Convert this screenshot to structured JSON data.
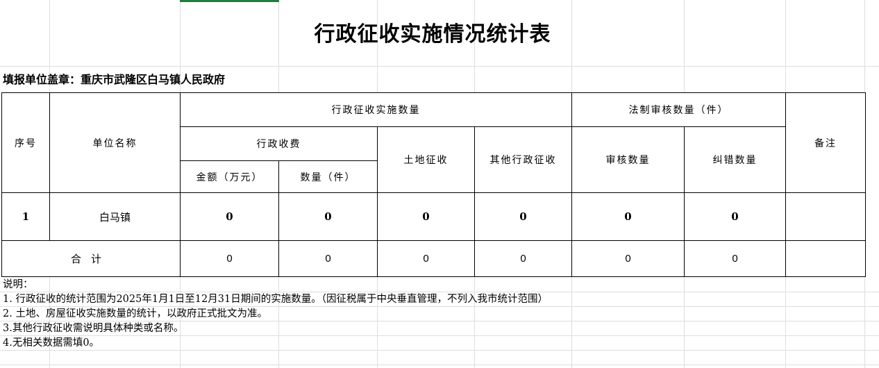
{
  "title": "行政征收实施情况统计表",
  "unit": "填报单位盖章：重庆市武隆区白马镇人民政府",
  "header": {
    "seq": "序号",
    "unit_name": "单位名称",
    "implementation_count": "行政征收实施数量",
    "admin_fee": "行政收费",
    "amount": "金额（万元）",
    "fee_count": "数量（件）",
    "land": "土地征收",
    "other": "其他行政征收",
    "legal_review": "法制审核数量（件）",
    "review_count": "审核数量",
    "correction_count": "纠错数量",
    "remark": "备注"
  },
  "rows": [
    {
      "seq": "1",
      "name": "白马镇",
      "amount": "0",
      "fee_count": "0",
      "land": "0",
      "other": "0",
      "review": "0",
      "correction": "0",
      "remark": ""
    }
  ],
  "total": {
    "label": "合计",
    "amount": "0",
    "fee_count": "0",
    "land": "0",
    "other": "0",
    "review": "0",
    "correction": "0",
    "remark": ""
  },
  "notes": [
    "说明：",
    "1.  行政征收的统计范围为2025年1月1日至12月31日期间的实施数量。（因征税属于中央垂直管理，不列入我市统计范围）",
    "2.  土地、房屋征收实施数量的统计，以政府正式批文为准。",
    "3.其他行政征收需说明具体种类或名称。",
    "4.无相关数据需填0。"
  ]
}
